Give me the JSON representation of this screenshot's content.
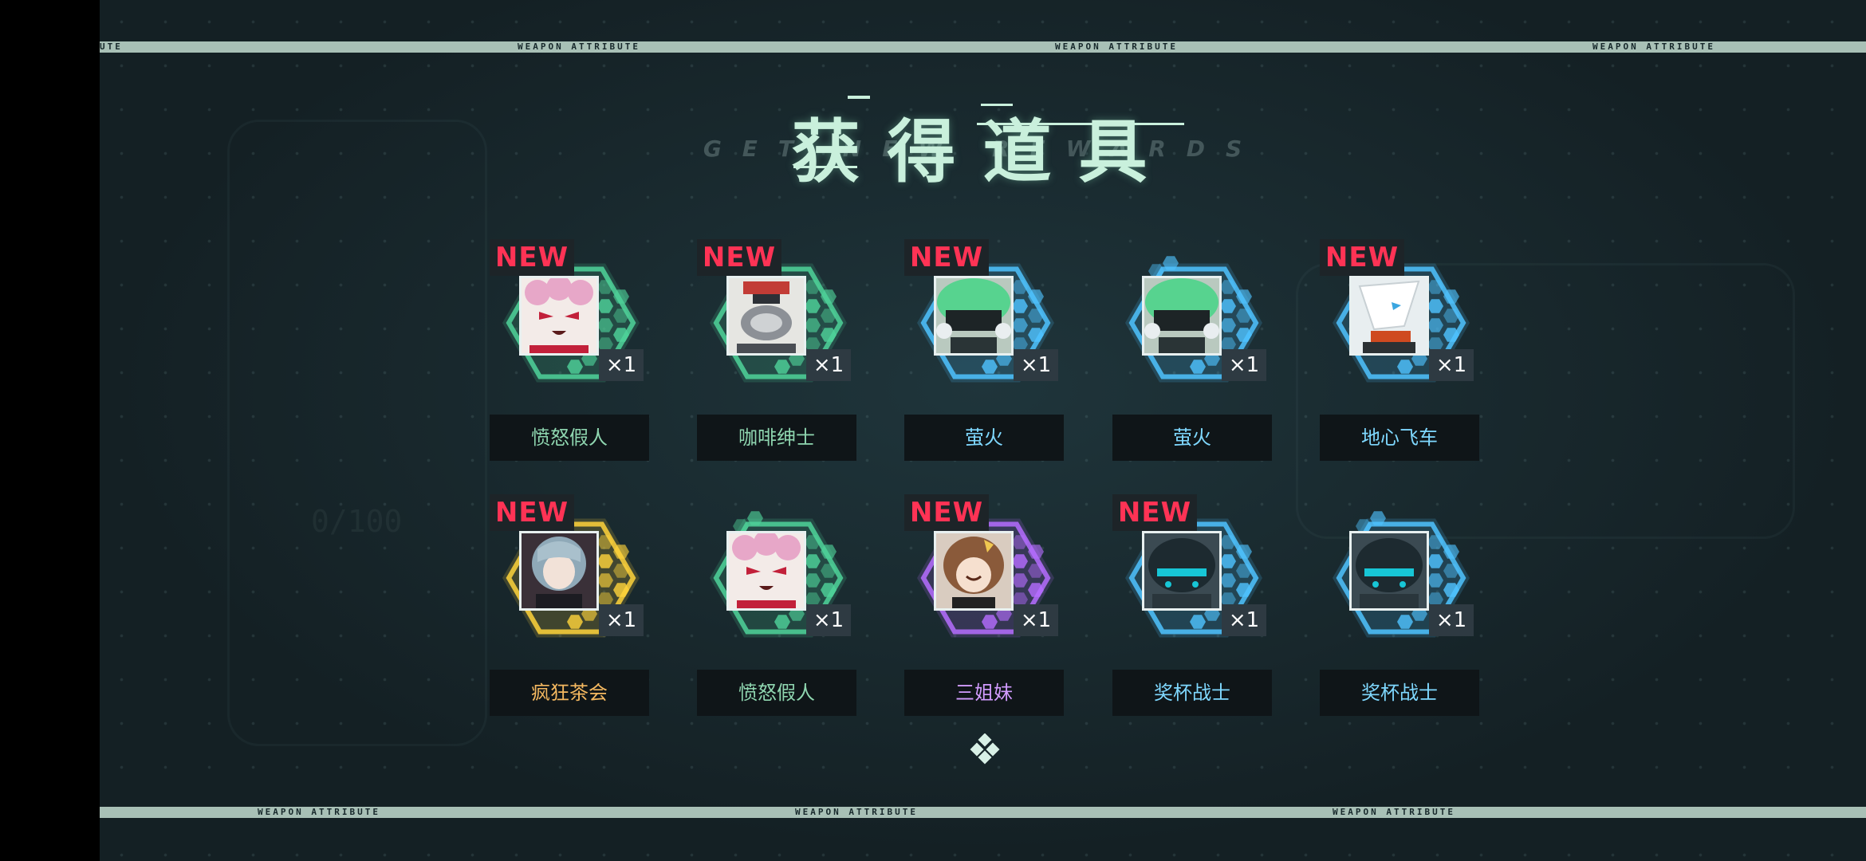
{
  "header": {
    "title_cn": "获得道具",
    "title_en": "GET NEW REWARDS"
  },
  "strips": {
    "top": [
      "UTE",
      "WEAPON ATTRIBUTE",
      "WEAPON ATTRIBUTE",
      "WEAPON ATTRIBUTE"
    ],
    "bottom": [
      "WEAPON ATTRIBUTE",
      "WEAPON ATTRIBUTE",
      "WEAPON ATTRIBUTE"
    ]
  },
  "background_text": {
    "counter": "0/100"
  },
  "items": [
    {
      "name": "愤怒假人",
      "new": "NEW",
      "qty": "×1",
      "rarity": "green",
      "art": "pink-doll",
      "name_color": "#8fd6b0"
    },
    {
      "name": "咖啡绅士",
      "new": "NEW",
      "qty": "×1",
      "rarity": "green",
      "art": "robot",
      "name_color": "#8fd6b0"
    },
    {
      "name": "萤火",
      "new": "NEW",
      "qty": "×1",
      "rarity": "blue",
      "art": "firefly",
      "name_color": "#7fd8ff"
    },
    {
      "name": "萤火",
      "new": "",
      "qty": "×1",
      "rarity": "blue",
      "art": "firefly",
      "name_color": "#7fd8ff"
    },
    {
      "name": "地心飞车",
      "new": "NEW",
      "qty": "×1",
      "rarity": "blue",
      "art": "white-bird",
      "name_color": "#7fd8ff"
    },
    {
      "name": "疯狂茶会",
      "new": "NEW",
      "qty": "×1",
      "rarity": "gold",
      "art": "silver-girl",
      "name_color": "#f4b860"
    },
    {
      "name": "愤怒假人",
      "new": "",
      "qty": "×1",
      "rarity": "green",
      "art": "pink-doll",
      "name_color": "#8fd6b0"
    },
    {
      "name": "三姐妹",
      "new": "NEW",
      "qty": "×1",
      "rarity": "purple",
      "art": "brown-girl",
      "name_color": "#d29cff"
    },
    {
      "name": "奖杯战士",
      "new": "NEW",
      "qty": "×1",
      "rarity": "blue",
      "art": "dark-helmet",
      "name_color": "#7fd8ff"
    },
    {
      "name": "奖杯战士",
      "new": "",
      "qty": "×1",
      "rarity": "blue",
      "art": "dark-helmet",
      "name_color": "#7fd8ff"
    }
  ],
  "rarity_colors": {
    "green": "#4fd39a",
    "blue": "#4fc3ff",
    "gold": "#ffd43b",
    "purple": "#b56dff"
  },
  "icons": {
    "pager": "diamond-cluster-icon"
  }
}
